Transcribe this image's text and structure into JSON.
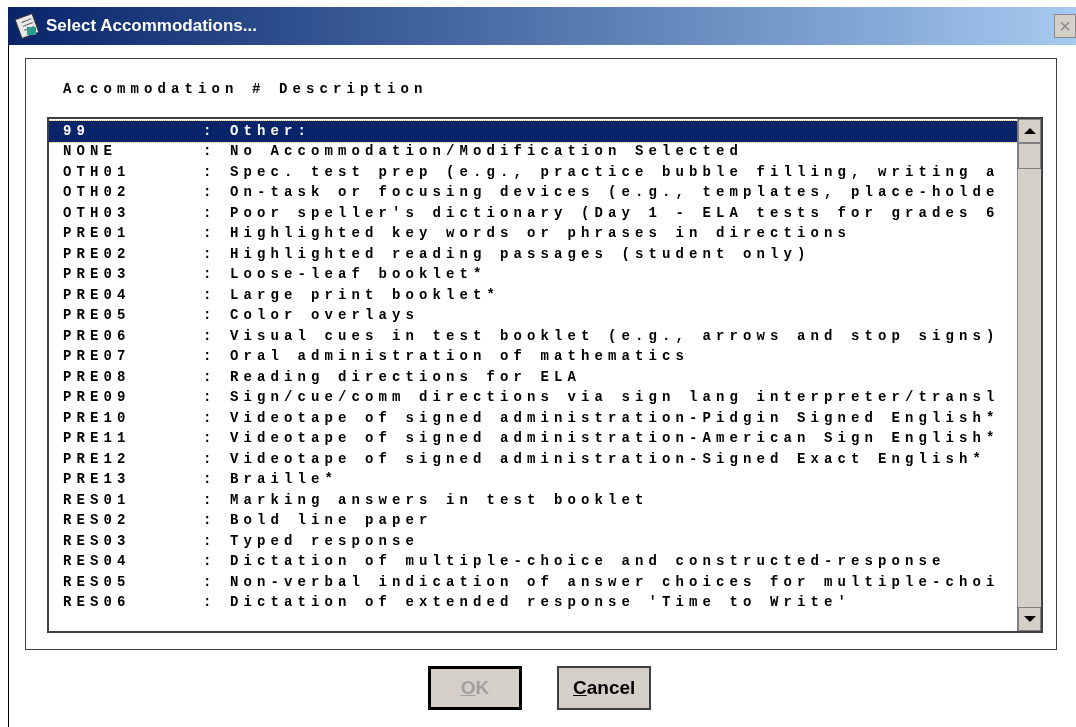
{
  "window": {
    "title": "Select Accommodations...",
    "close": "×"
  },
  "list": {
    "header": "Accommodation # Description",
    "rows": [
      {
        "code": "99",
        "description": ": Other:",
        "selected": true
      },
      {
        "code": "NONE",
        "description": ": No Accommodation/Modification Selected",
        "selected": false
      },
      {
        "code": "OTH01",
        "description": ": Spec. test prep (e.g., practice bubble filling, writing a",
        "selected": false
      },
      {
        "code": "OTH02",
        "description": ": On-task or focusing devices (e.g., templates, place-holde",
        "selected": false
      },
      {
        "code": "OTH03",
        "description": ": Poor speller's dictionary (Day 1 - ELA tests for grades 6",
        "selected": false
      },
      {
        "code": "PRE01",
        "description": ": Highlighted key words or phrases in directions",
        "selected": false
      },
      {
        "code": "PRE02",
        "description": ": Highlighted reading passages (student only)",
        "selected": false
      },
      {
        "code": "PRE03",
        "description": ": Loose-leaf booklet*",
        "selected": false
      },
      {
        "code": "PRE04",
        "description": ": Large print booklet*",
        "selected": false
      },
      {
        "code": "PRE05",
        "description": ": Color overlays",
        "selected": false
      },
      {
        "code": "PRE06",
        "description": ": Visual cues in test booklet (e.g., arrows and stop signs)",
        "selected": false
      },
      {
        "code": "PRE07",
        "description": ": Oral administration of mathematics",
        "selected": false
      },
      {
        "code": "PRE08",
        "description": ": Reading directions for ELA",
        "selected": false
      },
      {
        "code": "PRE09",
        "description": ": Sign/cue/comm directions via sign lang interpreter/transl",
        "selected": false
      },
      {
        "code": "PRE10",
        "description": ": Videotape of signed administration-Pidgin Signed English*",
        "selected": false
      },
      {
        "code": "PRE11",
        "description": ": Videotape of signed administration-American Sign English*",
        "selected": false
      },
      {
        "code": "PRE12",
        "description": ": Videotape of signed administration-Signed Exact English*",
        "selected": false
      },
      {
        "code": "PRE13",
        "description": ": Braille*",
        "selected": false
      },
      {
        "code": "RES01",
        "description": ": Marking answers in test booklet",
        "selected": false
      },
      {
        "code": "RES02",
        "description": ": Bold line paper",
        "selected": false
      },
      {
        "code": "RES03",
        "description": ": Typed response",
        "selected": false
      },
      {
        "code": "RES04",
        "description": ": Dictation of multiple-choice and constructed-response",
        "selected": false
      },
      {
        "code": "RES05",
        "description": ": Non-verbal indication of answer choices for multiple-choi",
        "selected": false
      },
      {
        "code": "RES06",
        "description": ": Dictation of extended response 'Time to Write'",
        "selected": false
      }
    ]
  },
  "buttons": [
    {
      "label": "OK",
      "disabled": true,
      "default": true,
      "mnemonic_underlined": true
    },
    {
      "label": "Cancel",
      "disabled": false,
      "default": false,
      "mnemonic_underlined": true
    }
  ]
}
